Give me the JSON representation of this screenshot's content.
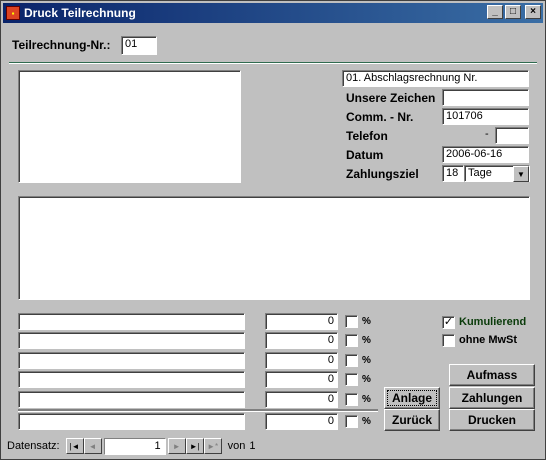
{
  "window": {
    "title": "Druck Teilrechnung",
    "min_glyph": "_",
    "max_glyph": "□",
    "close_glyph": "×"
  },
  "header": {
    "nr_label": "Teilrechnung-Nr.:",
    "nr_value": "01"
  },
  "right_panel": {
    "title_value": "01. Abschlagsrechnung Nr.",
    "unsere_zeichen_label": "Unsere Zeichen",
    "unsere_zeichen_value": "",
    "comm_nr_label": "Comm. - Nr.",
    "comm_nr_value": "101706",
    "telefon_label": "Telefon",
    "telefon_dash": "-",
    "telefon_value": "",
    "datum_label": "Datum",
    "datum_value": "2006-06-16",
    "zahlungsziel_label": "Zahlungsziel",
    "zahlungsziel_value": "18",
    "zahlungsziel_unit": "Tage"
  },
  "rows": [
    {
      "text": "",
      "amount": "0",
      "pct": "%"
    },
    {
      "text": "",
      "amount": "0",
      "pct": "%"
    },
    {
      "text": "",
      "amount": "0",
      "pct": "%"
    },
    {
      "text": "",
      "amount": "0",
      "pct": "%"
    },
    {
      "text": "",
      "amount": "0",
      "pct": "%"
    },
    {
      "text": "",
      "amount": "0",
      "pct": "%"
    }
  ],
  "options": {
    "kumulierend_label": "Kumulierend",
    "kumulierend_checked": true,
    "ohne_mwst_label": "ohne MwSt",
    "ohne_mwst_checked": false
  },
  "buttons": {
    "aufmass": "Aufmass",
    "anlage": "Anlage",
    "zahlungen": "Zahlungen",
    "zurueck": "Zurück",
    "drucken": "Drucken"
  },
  "nav": {
    "label": "Datensatz:",
    "record": "1",
    "of_label": "von",
    "total": "1",
    "first_glyph": "|◄",
    "prev_glyph": "◄",
    "next_glyph": "►",
    "last_glyph": "►|",
    "new_glyph": "►*"
  },
  "combo_arrow_glyph": "▼",
  "check_mark": "✓",
  "colors": {
    "separator": "#2f6b4f",
    "title_start": "#0a246a",
    "title_end": "#3a6ea5"
  }
}
